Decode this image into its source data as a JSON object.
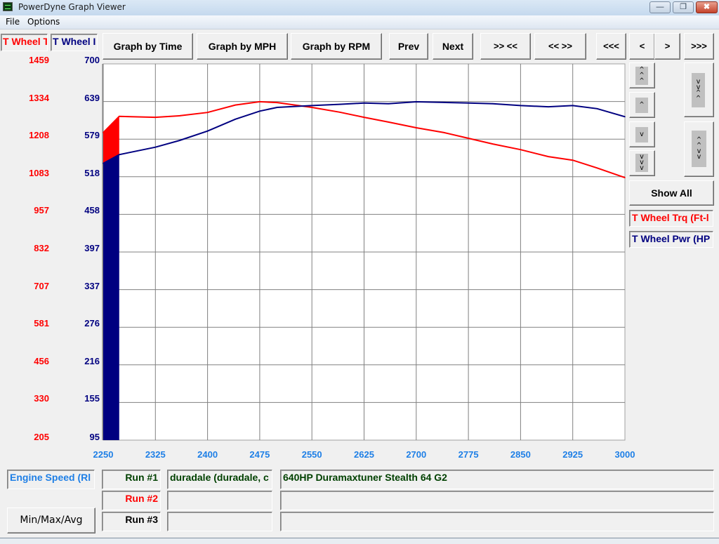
{
  "window": {
    "title": "PowerDyne Graph Viewer",
    "icon": "oscilloscope-icon",
    "controls": {
      "minimize": "—",
      "maximize": "❐",
      "close": "✖"
    }
  },
  "menu": {
    "items": [
      "File",
      "Options"
    ]
  },
  "toolbar": {
    "axis_tab_left": "T Wheel T",
    "axis_tab_right": "T Wheel I",
    "graph_by_time": "Graph by Time",
    "graph_by_mph": "Graph by MPH",
    "graph_by_rpm": "Graph by RPM",
    "prev": "Prev",
    "next": "Next",
    "zoom_in": ">> <<",
    "zoom_out": "<< >>",
    "first": "<<<",
    "left": "<",
    "right": ">",
    "last": ">>>"
  },
  "side_panel": {
    "scroll_up_fast": "^\n^\n^",
    "scroll_up": "^",
    "scroll_down": "v",
    "scroll_down_fast": "v\nv\nv",
    "expand_top": "v\nv\n^\n^",
    "expand_bottom": "^\n^\nv\nv",
    "show_all": "Show All",
    "legend": [
      {
        "label": "T Wheel Trq (Ft-l",
        "color": "#ff0000"
      },
      {
        "label": "T Wheel Pwr (HP",
        "color": "#000080"
      }
    ]
  },
  "bottom": {
    "x_channel": "Engine Speed (Rl",
    "min_max_avg": "Min/Max/Avg",
    "runs": [
      {
        "label": "Run #1",
        "color": "#004000",
        "name": "duradale (duradale, c",
        "description": "640HP Duramaxtuner Stealth 64 G2"
      },
      {
        "label": "Run #2",
        "color": "#ff0000",
        "name": "",
        "description": ""
      },
      {
        "label": "Run #3",
        "color": "#000000",
        "name": "",
        "description": ""
      }
    ]
  },
  "chart_data": {
    "type": "line",
    "title": "",
    "xlabel": "Engine Speed (RPM)",
    "x_ticks": [
      2250,
      2325,
      2400,
      2475,
      2550,
      2625,
      2700,
      2775,
      2850,
      2925,
      3000
    ],
    "xlim": [
      2250,
      3000
    ],
    "y_left": {
      "label": "T Wheel Trq (Ft-lb)",
      "ticks": [
        1459,
        1334,
        1208,
        1083,
        957,
        832,
        707,
        581,
        456,
        330,
        205
      ],
      "ylim": [
        205,
        1459
      ],
      "color": "#ff0000"
    },
    "y_right": {
      "label": "T Wheel Pwr (HP)",
      "ticks": [
        700,
        639,
        579,
        518,
        458,
        397,
        337,
        276,
        216,
        155,
        95
      ],
      "ylim": [
        95,
        700
      ],
      "color": "#000080"
    },
    "grid": true,
    "series": [
      {
        "name": "T Wheel Trq (Ft-lb)",
        "axis": "left",
        "color": "#ff0000",
        "x": [
          2250,
          2273,
          2290,
          2325,
          2360,
          2400,
          2440,
          2475,
          2500,
          2550,
          2590,
          2625,
          2660,
          2700,
          2740,
          2775,
          2810,
          2850,
          2890,
          2925,
          2960,
          3000
        ],
        "values": [
          1230,
          1284,
          1283,
          1281,
          1286,
          1297,
          1322,
          1333,
          1330,
          1314,
          1298,
          1281,
          1265,
          1246,
          1230,
          1211,
          1192,
          1173,
          1150,
          1138,
          1112,
          1080
        ]
      },
      {
        "name": "T Wheel Pwr (HP)",
        "axis": "right",
        "color": "#000080",
        "x": [
          2250,
          2273,
          2290,
          2325,
          2360,
          2400,
          2440,
          2475,
          2500,
          2550,
          2590,
          2625,
          2660,
          2700,
          2740,
          2775,
          2810,
          2850,
          2890,
          2925,
          2960,
          3000
        ],
        "values": [
          540,
          554,
          558,
          566,
          577,
          592,
          611,
          624,
          630,
          633,
          635,
          637,
          636,
          639,
          638,
          637,
          636,
          633,
          631,
          633,
          628,
          615
        ]
      }
    ],
    "fill_segment": {
      "x_end": 2273,
      "note": "solid filled region at start of sweep for both series"
    }
  }
}
